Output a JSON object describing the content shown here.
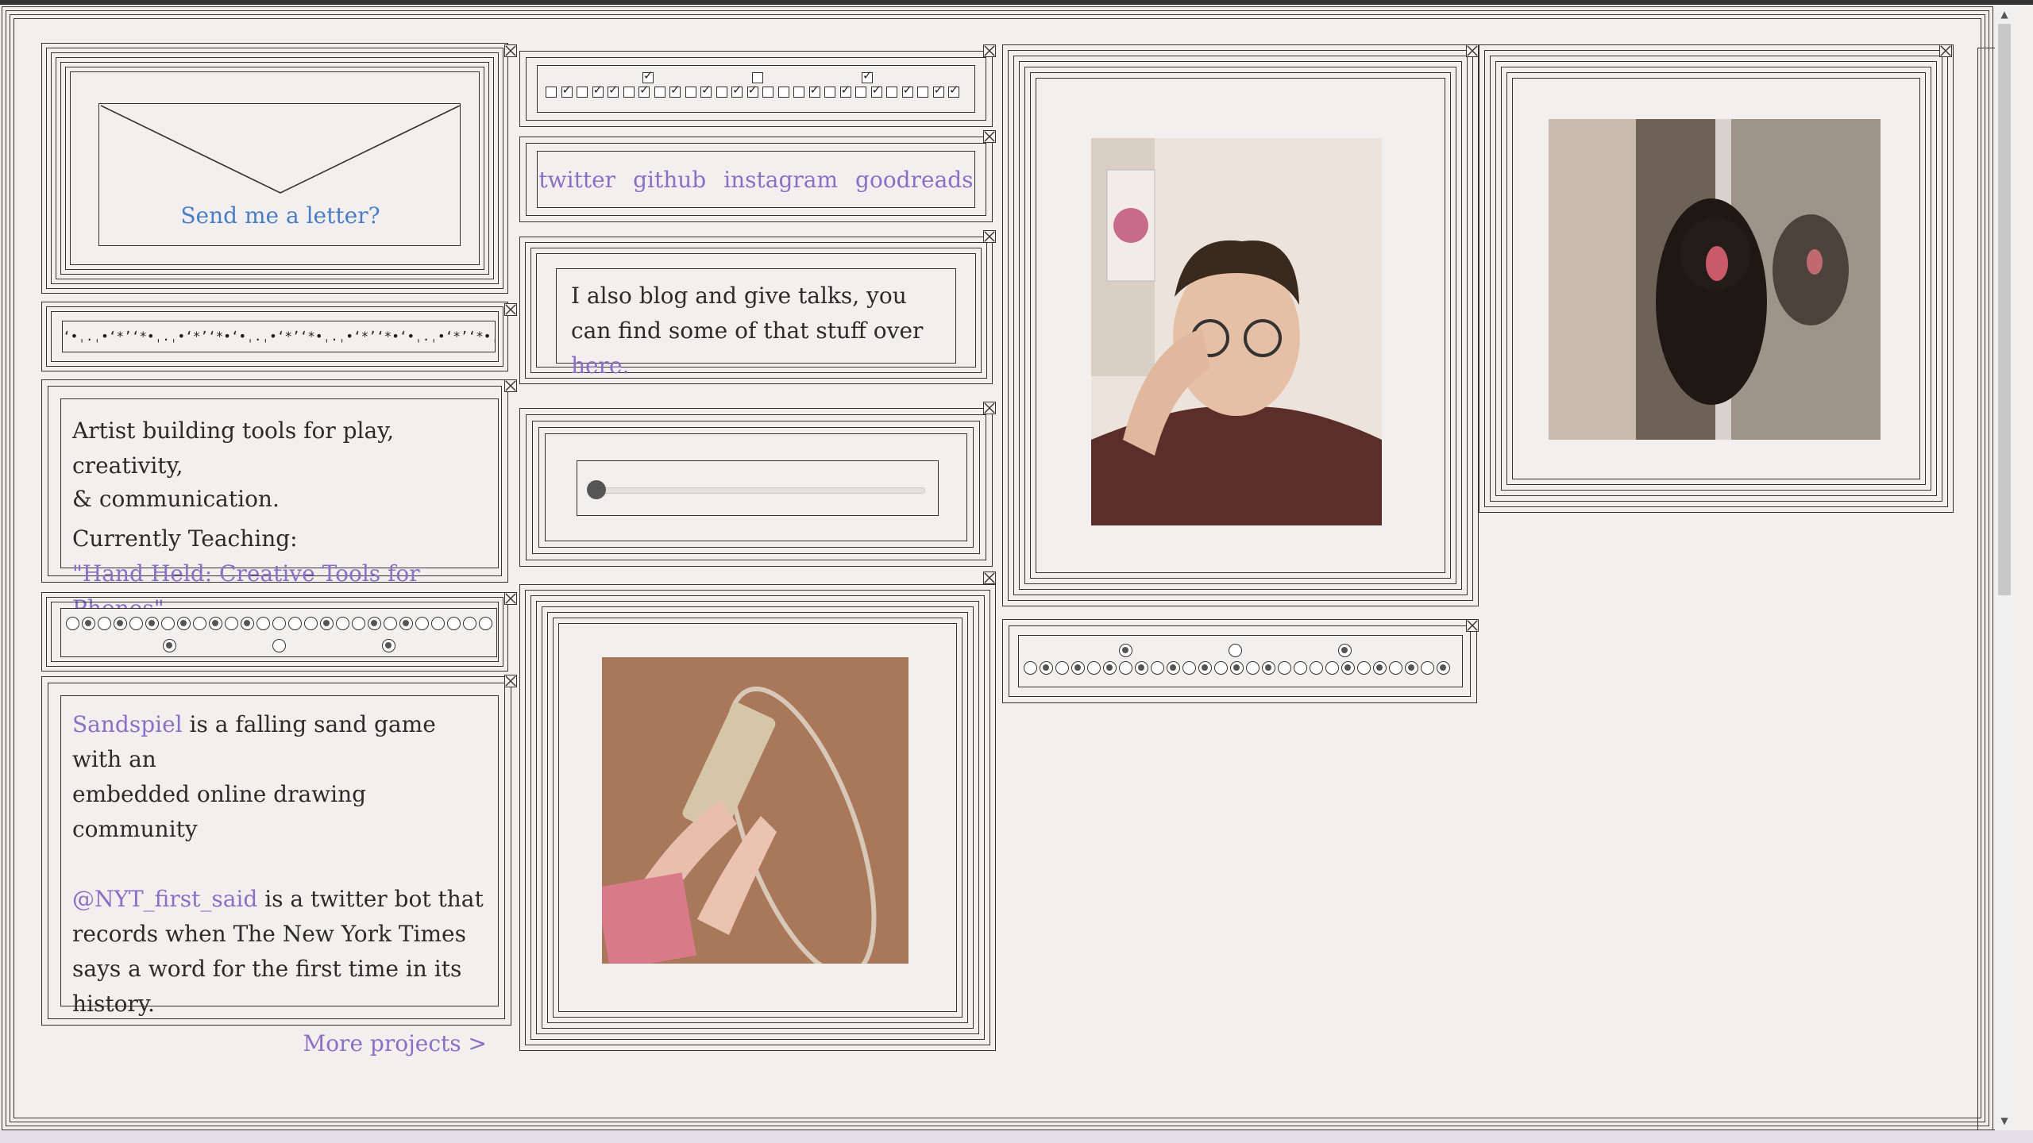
{
  "letter": {
    "label": "Send me a letter?"
  },
  "social": {
    "links": [
      "twitter",
      "github",
      "instagram",
      "goodreads"
    ]
  },
  "blog": {
    "text": "I also blog and give talks, you can find some of that stuff over",
    "link": "here."
  },
  "bio": {
    "line1": "Artist building tools for play, creativity,",
    "line2": "& communication.",
    "teaching_label": "Currently Teaching:",
    "course": "\"Hand Held: Creative Tools for Phones\""
  },
  "projects": {
    "p1_link": "Sandspiel",
    "p1_text_a": " is a falling sand game with an",
    "p1_text_b": "embedded online drawing community",
    "p2_link": "@NYT_first_said",
    "p2_text_a": " is a twitter bot that",
    "p2_text_b": "records when The New York Times",
    "p2_text_c": "says a word for the first time in its",
    "p2_text_d": "history.",
    "more": "More projects >"
  },
  "slider": {
    "value": 0
  },
  "checkboxes": {
    "row": [
      false,
      true,
      false,
      true,
      true,
      false,
      true,
      false,
      true,
      false,
      true,
      false,
      true,
      true,
      false,
      false,
      false,
      true,
      false,
      true,
      false,
      true,
      false,
      true,
      false,
      true,
      true
    ],
    "top_checked": [
      true,
      false,
      true
    ]
  },
  "radios_left": {
    "row": [
      false,
      true,
      false,
      true,
      false,
      true,
      false,
      true,
      false,
      true,
      false,
      true,
      false,
      false,
      false,
      false,
      true,
      false,
      false,
      true,
      false,
      true,
      false,
      false,
      false,
      false,
      false
    ],
    "below_checked": [
      true,
      false,
      true
    ]
  },
  "radios_right": {
    "row": [
      false,
      true,
      false,
      true,
      false,
      true,
      false,
      true,
      false,
      true,
      false,
      true,
      false,
      true,
      false,
      true,
      false,
      false,
      false,
      false,
      true,
      false,
      true,
      false,
      true,
      false,
      true
    ],
    "above_checked": [
      true,
      false,
      true
    ]
  },
  "sand_strip": {
    "text": "ʻ•ˌ.ˌ•ʻ*ʼʻ*•ˌ.ˌ•ʻ*ʼʻ*•ʻ•ˌ.ˌ•ʻ*ʼʻ*•ˌ.ˌ•ʻ*ʼʻ*•ʻ•ˌ.ˌ•ʻ*ʼʻ*•ˌ.ˌ•ʻ*ʼʻ*•"
  },
  "colors": {
    "background": "#f3efef",
    "link": "#8a6fc4",
    "letter_link": "#4a7ec4",
    "border": "#333333"
  }
}
